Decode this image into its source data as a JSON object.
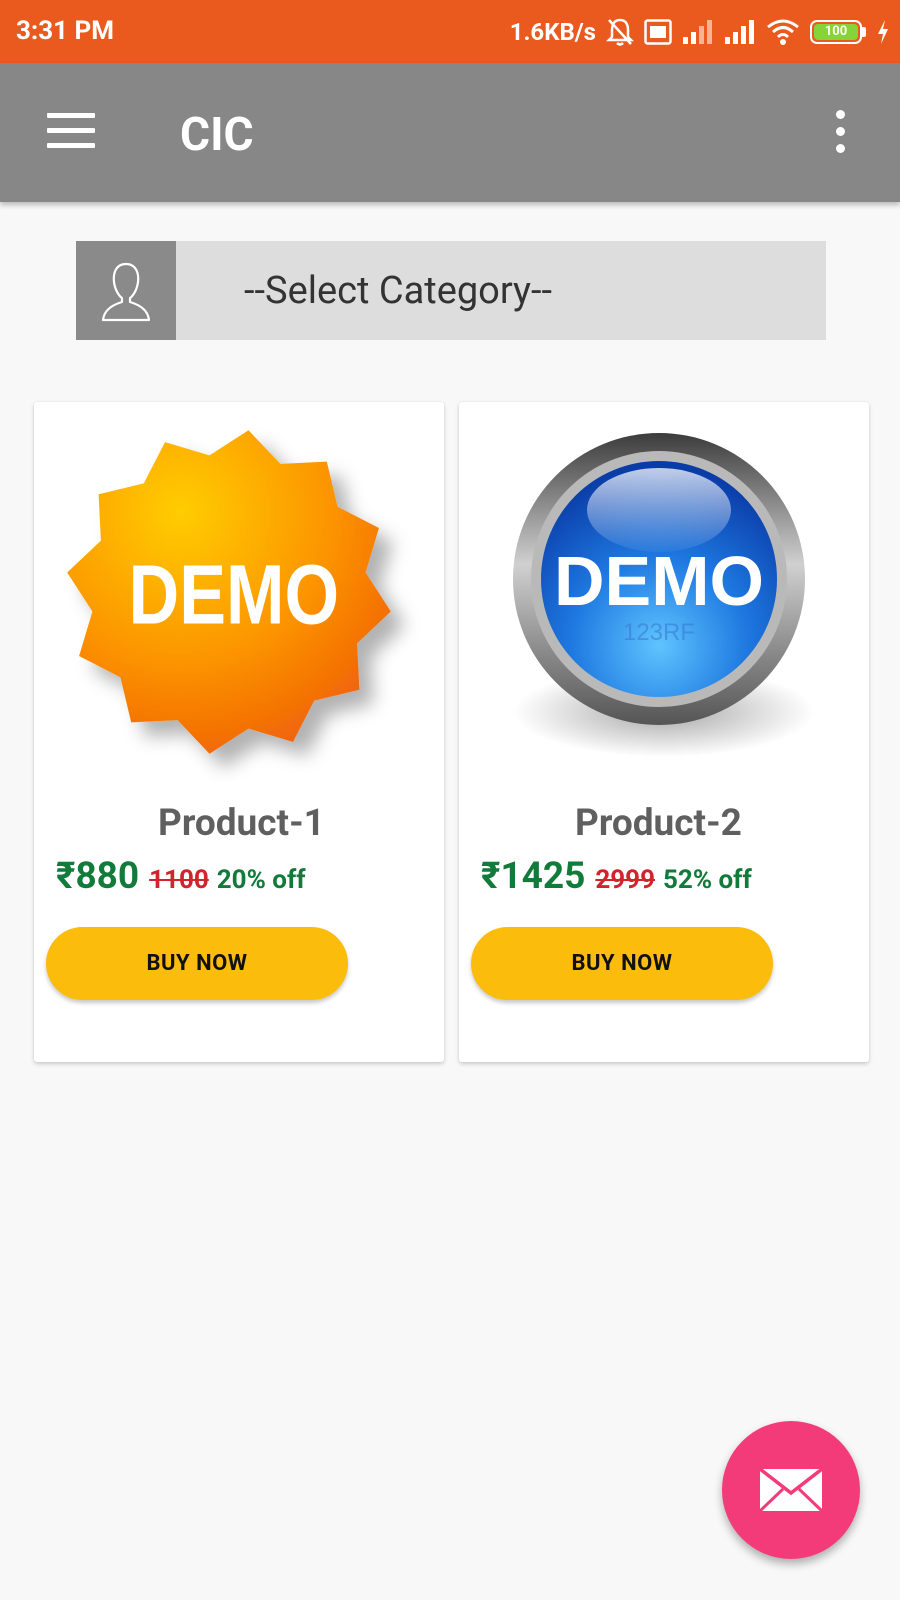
{
  "status_bar": {
    "time": "3:31 PM",
    "network_speed": "1.6KB/s",
    "battery_level": "100",
    "icons": [
      "bell-off-icon",
      "volte-icon",
      "signal-icon",
      "signal-icon",
      "wifi-icon",
      "battery-icon",
      "charging-icon"
    ]
  },
  "app_bar": {
    "title": "CIC",
    "menu_icon": "hamburger-menu-icon",
    "overflow_icon": "more-vertical-icon"
  },
  "category": {
    "placeholder": "--Select Category--",
    "icon": "user-icon"
  },
  "products": [
    {
      "image_text": "DEMO",
      "name": "Product-1",
      "price": "₹880",
      "original_price": "1100",
      "discount": "20% off",
      "button_label": "BUY NOW"
    },
    {
      "image_text": "DEMO",
      "image_watermark": "123RF",
      "name": "Product-2",
      "price": "₹1425",
      "original_price": "2999",
      "discount": "52% off",
      "button_label": "BUY NOW"
    }
  ],
  "fab": {
    "icon": "mail-icon"
  },
  "colors": {
    "status_bar": "#ea5a1e",
    "app_bar": "#878787",
    "price_green": "#127a3a",
    "old_price_red": "#d0252b",
    "buy_button": "#fbbc0b",
    "fab": "#f43b7a"
  }
}
